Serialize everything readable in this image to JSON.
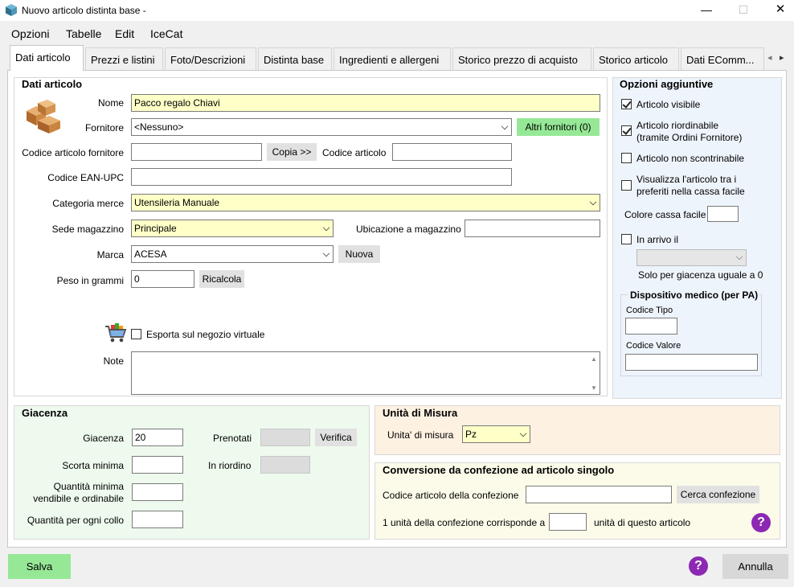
{
  "window": {
    "title": "Nuovo articolo distinta base -",
    "min": "—",
    "max": "☐",
    "close": "✕"
  },
  "menu": [
    "Opzioni",
    "Tabelle",
    "Edit",
    "IceCat"
  ],
  "tabs": [
    "Dati articolo",
    "Prezzi e listini",
    "Foto/Descrizioni",
    "Distinta base",
    "Ingredienti e allergeni",
    "Storico prezzo di acquisto",
    "Storico articolo",
    "Dati  EComm..."
  ],
  "tab_scroll": {
    "left": "◂",
    "right": "▸"
  },
  "dati": {
    "title": "Dati articolo",
    "nome_label": "Nome",
    "nome_value": "Pacco regalo Chiavi",
    "fornitore_label": "Fornitore",
    "fornitore_value": "<Nessuno>",
    "altri_fornitori": "Altri fornitori (0)",
    "codice_fornitore_label": "Codice articolo fornitore",
    "codice_fornitore_value": "",
    "copia": "Copia >>",
    "codice_articolo_label": "Codice articolo",
    "codice_articolo_value": "",
    "ean_label": "Codice EAN-UPC",
    "ean_value": "",
    "categoria_label": "Categoria merce",
    "categoria_value": "Utensileria Manuale",
    "sede_label": "Sede magazzino",
    "sede_value": "Principale",
    "ubicazione_label": "Ubicazione a magazzino",
    "ubicazione_value": "",
    "marca_label": "Marca",
    "marca_value": "ACESA",
    "nuova": "Nuova",
    "peso_label": "Peso in grammi",
    "peso_value": "0",
    "ricalcola": "Ricalcola",
    "esporta_label": "Esporta sul negozio virtuale",
    "note_label": "Note",
    "note_value": ""
  },
  "opzioni": {
    "title": "Opzioni aggiuntive",
    "visibile": "Articolo visibile",
    "riordinabile1": "Articolo riordinabile",
    "riordinabile2": "(tramite Ordini Fornitore)",
    "non_scontrinabile": "Articolo non scontrinabile",
    "preferiti1": "Visualizza l'articolo tra i",
    "preferiti2": "preferiti nella cassa facile",
    "colore_label": "Colore cassa facile",
    "colore_value": "",
    "in_arrivo": "In arrivo il",
    "in_arrivo_value": "",
    "solo_giacenza": "Solo per giacenza uguale a 0",
    "dispositivo_title": "Dispositivo medico (per PA)",
    "codice_tipo_label": "Codice Tipo",
    "codice_tipo_value": "",
    "codice_valore_label": "Codice Valore",
    "codice_valore_value": ""
  },
  "giacenza": {
    "title": "Giacenza",
    "giacenza_label": "Giacenza",
    "giacenza_value": "20",
    "prenotati_label": "Prenotati",
    "prenotati_value": "",
    "verifica": "Verifica",
    "scorta_label": "Scorta minima",
    "scorta_value": "",
    "riordino_label": "In riordino",
    "riordino_value": "",
    "qmin1": "Quantità minima",
    "qmin2": "vendibile e ordinabile",
    "qmin_value": "",
    "collo_label": "Quantità per ogni collo",
    "collo_value": ""
  },
  "unita": {
    "title": "Unità di Misura",
    "label": "Unita' di misura",
    "value": "Pz"
  },
  "conversione": {
    "title": "Conversione da confezione ad articolo singolo",
    "codice_label": "Codice articolo della confezione",
    "codice_value": "",
    "cerca": "Cerca confezione",
    "unita_pre": "1 unità della confezione corrisponde a",
    "unita_value": "",
    "unita_post": "unità di questo articolo",
    "help": "?"
  },
  "footer": {
    "salva": "Salva",
    "annulla": "Annulla",
    "help": "?"
  },
  "colors": {
    "yellow_field": "#ffffc8",
    "green_button": "#96e896",
    "help_purple": "#8c28b4",
    "panel_blue": "#eef4fb",
    "panel_green": "#eefaee",
    "panel_orange": "#fdf1e2",
    "panel_cream": "#fcfbe9"
  }
}
